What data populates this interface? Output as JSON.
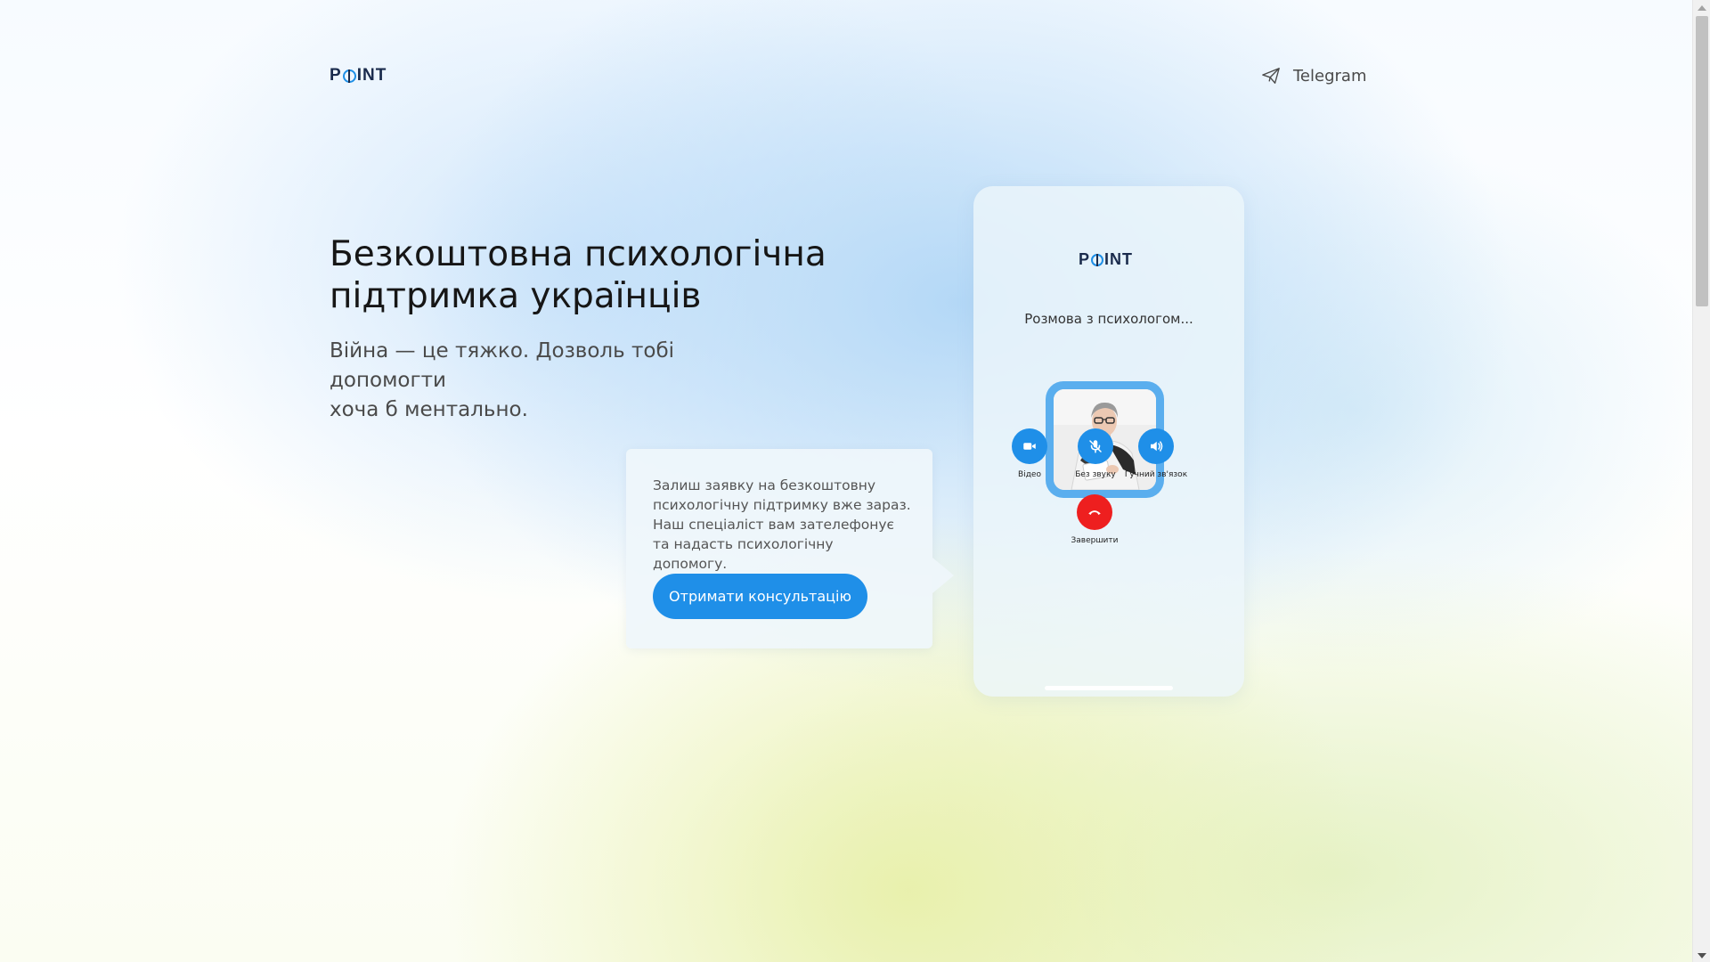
{
  "brand": {
    "logo_left": "P",
    "logo_right": "INT"
  },
  "header": {
    "telegram_label": "Telegram"
  },
  "hero": {
    "title_line1": "Безкоштовна психологічна",
    "title_line2": "підтримка українців",
    "subtitle_line1": "Війна — це тяжко. Дозволь тобі допомогти",
    "subtitle_line2": "хоча б ментально."
  },
  "bubble": {
    "text": "Залиш заявку на безкоштовну психологічну підтримку вже зараз. Наш спеціаліст вам зателефонує та надасть психологічну допомогу.",
    "cta_label": "Отримати консультацію"
  },
  "phone": {
    "status": "Розмова з психологом...",
    "controls": {
      "video": "Відео",
      "mute": "Без звуку",
      "speaker": "Гучний зв'язок",
      "end": "Завершити"
    }
  },
  "colors": {
    "accent": "#1f8fe8",
    "end_call": "#ee1f1f",
    "logo_text": "#1a2b4c"
  }
}
